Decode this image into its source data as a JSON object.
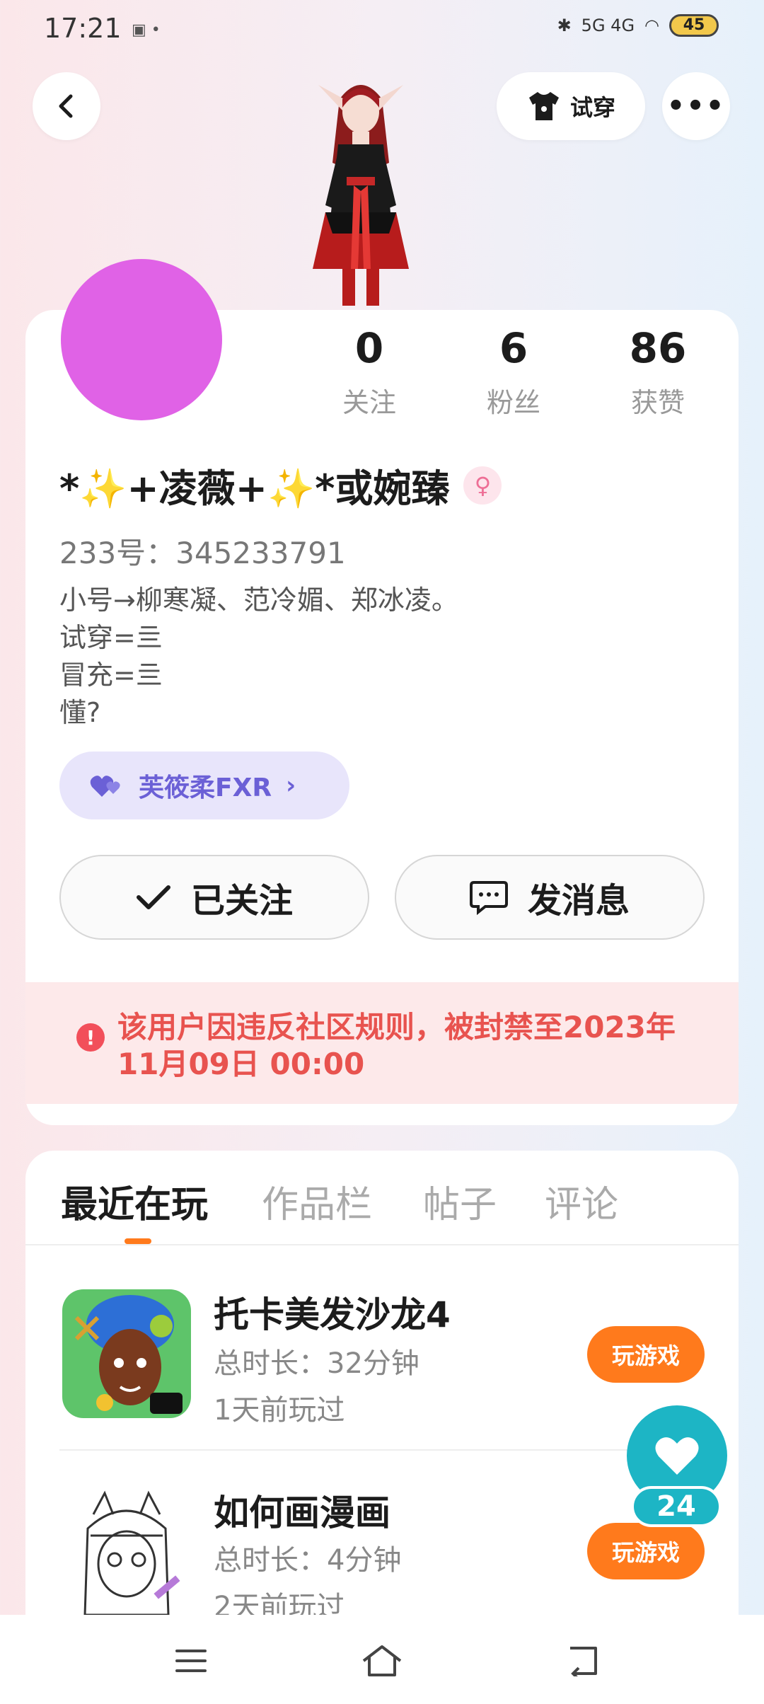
{
  "status_bar": {
    "time": "17:21",
    "indicators": "▣ •",
    "signal": "5G 4G",
    "battery": "45"
  },
  "header": {
    "back_icon": "chevron-left-icon",
    "tryon_label": "试穿",
    "more_icon": "more-dots-icon"
  },
  "profile": {
    "stats": [
      {
        "value": "0",
        "label": "关注"
      },
      {
        "value": "6",
        "label": "粉丝"
      },
      {
        "value": "86",
        "label": "获赞"
      }
    ],
    "nickname": "*✨+凌薇+✨*或婉臻",
    "gender_symbol": "♀",
    "uid": "233号：345233791",
    "bio_lines": [
      "小号→柳寒凝、范冷媚、郑冰凌。",
      "试穿=亖",
      "冒充=亖",
      "懂?"
    ],
    "club_label": "芙筱柔FXR",
    "follow_label": "已关注",
    "message_label": "发消息",
    "ban_notice": "该用户因违反社区规则，被封禁至2023年11月09日 00:00"
  },
  "tabs": [
    {
      "label": "最近在玩",
      "active": true
    },
    {
      "label": "作品栏",
      "active": false
    },
    {
      "label": "帖子",
      "active": false
    },
    {
      "label": "评论",
      "active": false
    }
  ],
  "games": [
    {
      "name": "托卡美发沙龙4",
      "duration": "总时长：32分钟",
      "last_played": "1天前玩过",
      "button": "玩游戏"
    },
    {
      "name": "如何画漫画",
      "duration": "总时长：4分钟",
      "last_played": "2天前玩过",
      "button": "玩游戏"
    }
  ],
  "like_count": "24",
  "colors": {
    "accent_orange": "#ff7a1c",
    "ban_red": "#e8534f",
    "fab_teal": "#1db5c5",
    "avatar_pink": "#e062e6"
  }
}
